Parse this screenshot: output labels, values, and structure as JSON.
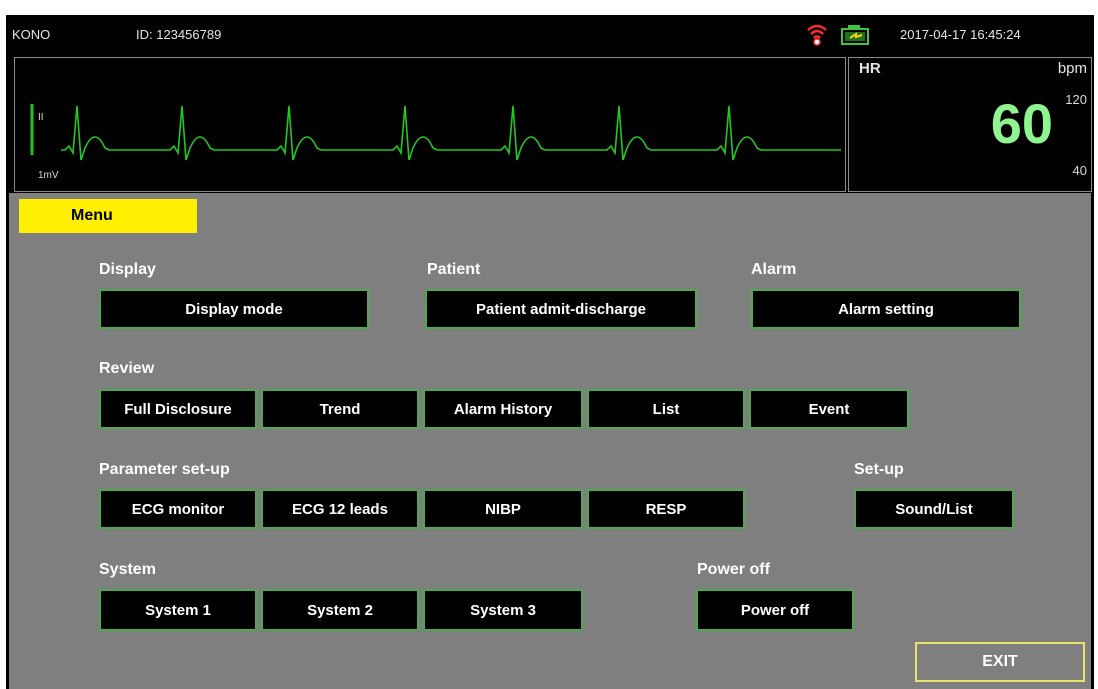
{
  "status": {
    "brand": "KONO",
    "patient_id": "ID: 123456789",
    "datetime": "2017-04-17  16:45:24",
    "wifi_icon": "wifi-alarm-icon",
    "battery_icon": "battery-charging-icon"
  },
  "ecg": {
    "lead": "II",
    "scale": "1mV",
    "trace_color": "#22c822"
  },
  "hr": {
    "label": "HR",
    "unit": "bpm",
    "value": "60",
    "high_limit": "120",
    "low_limit": "40",
    "value_color": "#8ff58f"
  },
  "menu": {
    "tab_label": "Menu",
    "display": {
      "title": "Display",
      "buttons": [
        "Display mode"
      ]
    },
    "patient": {
      "title": "Patient",
      "buttons": [
        "Patient admit-discharge"
      ]
    },
    "alarm": {
      "title": "Alarm",
      "buttons": [
        "Alarm setting"
      ]
    },
    "review": {
      "title": "Review",
      "buttons": [
        "Full Disclosure",
        "Trend",
        "Alarm History",
        "List",
        "Event"
      ]
    },
    "parameter": {
      "title": "Parameter set-up",
      "buttons": [
        "ECG monitor",
        "ECG 12 leads",
        "NIBP",
        "RESP"
      ]
    },
    "setup": {
      "title": "Set-up",
      "buttons": [
        "Sound/List"
      ]
    },
    "system": {
      "title": "System",
      "buttons": [
        "System 1",
        "System 2",
        "System 3"
      ]
    },
    "power": {
      "title": "Power off",
      "buttons": [
        "Power off"
      ]
    },
    "exit_label": "EXIT"
  },
  "colors": {
    "menu_bg": "#7f7f7f",
    "tab_yellow": "#ffef00",
    "button_border": "#4ea84e",
    "exit_border": "#e8e46a"
  }
}
